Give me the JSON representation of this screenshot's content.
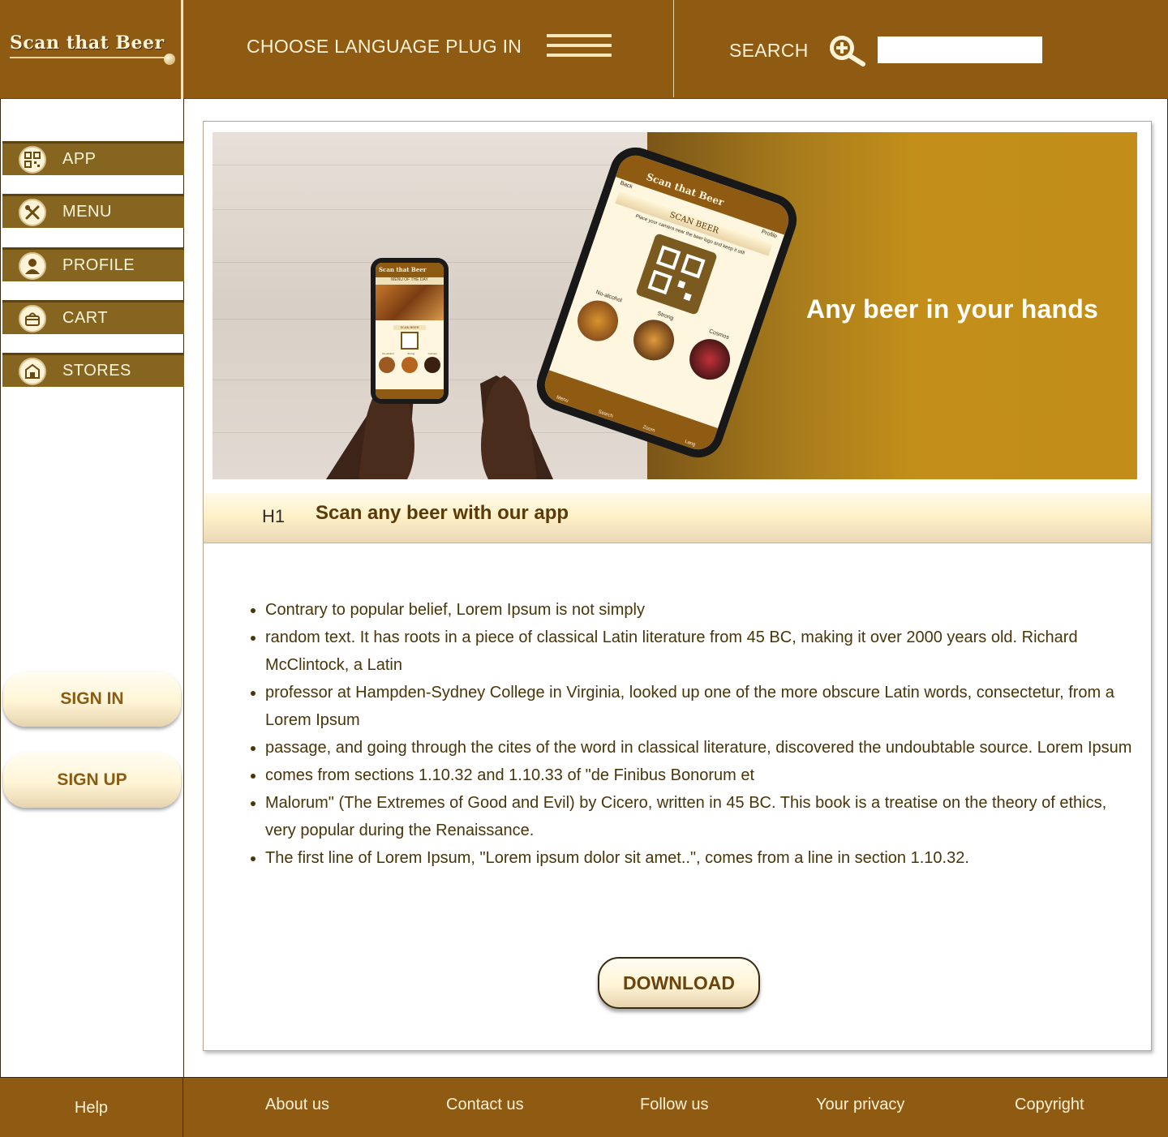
{
  "header": {
    "logo_text": "Scan that Beer",
    "language_label": "CHOOSE LANGUAGE PLUG IN",
    "menu_icon": "hamburger-icon",
    "search_label": "SEARCH",
    "search_icon": "zoom-in-magnifier-icon",
    "search_value": ""
  },
  "sidebar": {
    "items": [
      {
        "label": "APP",
        "icon": "qr-code-icon"
      },
      {
        "label": "MENU",
        "icon": "fork-spoon-icon"
      },
      {
        "label": "PROFILE",
        "icon": "user-icon"
      },
      {
        "label": "CART",
        "icon": "basket-icon"
      },
      {
        "label": "STORES",
        "icon": "store-icon"
      }
    ],
    "sign_in": "SIGN IN",
    "sign_up": "SIGN UP"
  },
  "hero": {
    "tagline": "Any beer in your hands",
    "phone": {
      "app_title": "Scan that Beer",
      "back": "Back",
      "profile": "Profile",
      "screen_title": "SCAN BEER",
      "instructions": "Place your camera near the beer logo and keep it still",
      "categories": [
        "No-alcohol",
        "Strong",
        "Cosmos"
      ],
      "tabs": [
        "Menu",
        "Search",
        "Zoom",
        "Lang"
      ]
    },
    "small_phone": {
      "app_title": "Scan that Beer",
      "banner": "MENU OF THE DAY",
      "button": "SCAN BEER",
      "categories": [
        "No-alcohol",
        "Strong",
        "Cosmos"
      ]
    }
  },
  "main": {
    "heading_tag": "H1",
    "heading": "Scan any beer with our app",
    "bullets": [
      "Contrary to popular belief, Lorem Ipsum is not simply",
      "random text. It has roots in a piece of classical Latin literature from 45 BC, making it over 2000 years old. Richard McClintock, a Latin",
      "professor at Hampden-Sydney College in Virginia, looked up one of the more obscure Latin words, consectetur, from a Lorem Ipsum",
      "passage, and going through the cites of the word in classical literature, discovered the undoubtable source. Lorem Ipsum",
      "comes from sections 1.10.32 and 1.10.33 of \"de Finibus Bonorum et",
      " Malorum\" (The Extremes of Good and Evil) by Cicero, written in 45 BC. This book is a treatise on the theory of ethics, very popular during the Renaissance.",
      "The first line of Lorem Ipsum, \"Lorem ipsum dolor sit amet..\", comes from a line in section 1.10.32."
    ],
    "download_label": "DOWNLOAD"
  },
  "footer": {
    "help": "Help",
    "links": [
      "About us",
      "Contact us",
      "Follow us",
      "Your privacy",
      "Copyright"
    ]
  },
  "colors": {
    "header_brown": "#8f5a12",
    "nav_olive": "#85651f",
    "hero_gold": "#c38f1a",
    "heading_text": "#5a3a08"
  }
}
